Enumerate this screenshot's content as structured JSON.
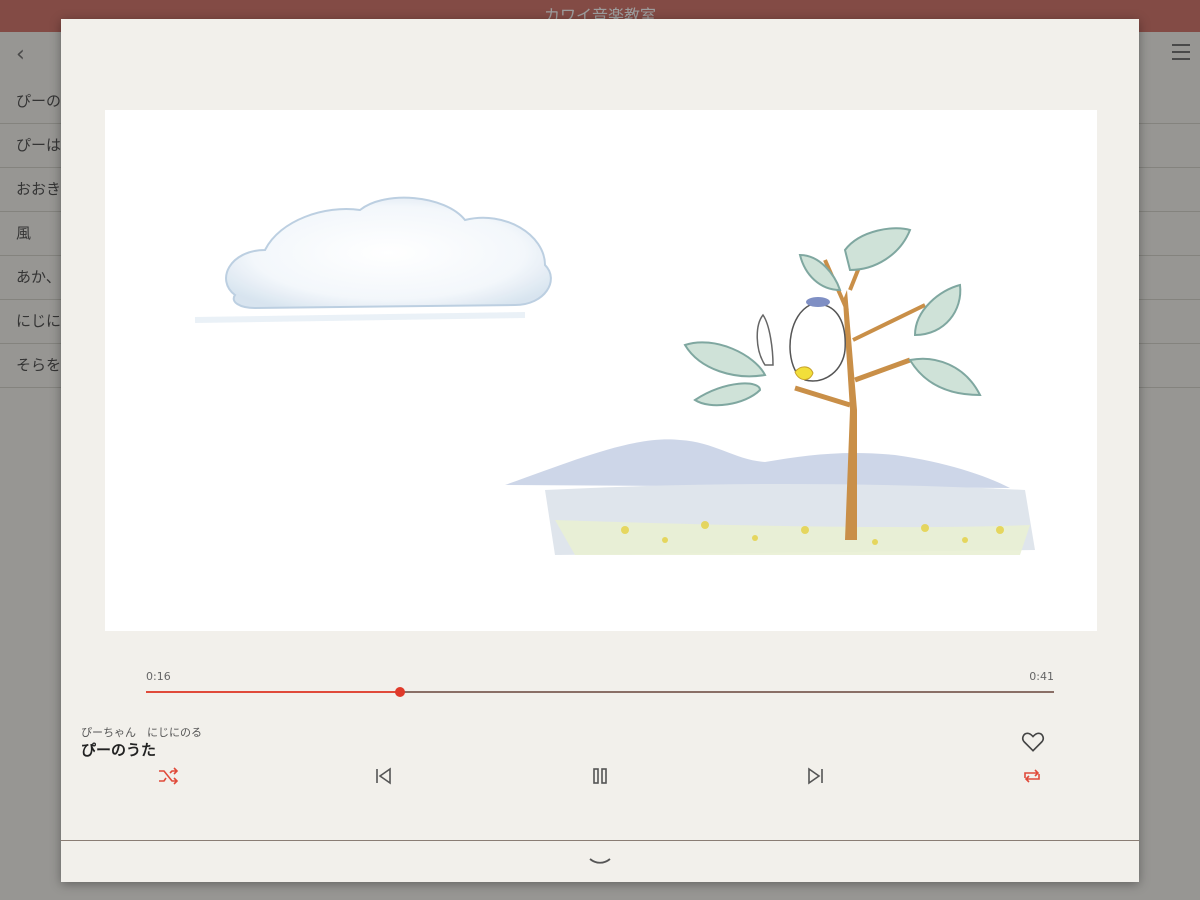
{
  "background": {
    "app_title": "カワイ音楽教室",
    "list_items": [
      "ぴーの",
      "ぴーは",
      "おおき",
      "風",
      "あか、",
      "にじに",
      "そらを"
    ]
  },
  "player": {
    "current_time": "0:16",
    "duration": "0:41",
    "progress": 0.28,
    "artist_line": "ぴーちゃん　にじにのる",
    "track_title": "ぴーのうた",
    "liked": false,
    "shuffle_on": true,
    "repeat_on": true,
    "playing": true
  },
  "icons": {
    "shuffle": "shuffle-icon",
    "previous": "skip-previous-icon",
    "pause": "pause-icon",
    "next": "skip-next-icon",
    "repeat": "repeat-icon",
    "like": "heart-icon",
    "collapse": "chevron-down-icon",
    "back": "chevron-left-icon",
    "menu": "hamburger-menu-icon"
  },
  "colors": {
    "accent": "#e04a3a",
    "header": "#d47a70",
    "panel": "#f2f0eb",
    "track": "#8a6f66"
  }
}
